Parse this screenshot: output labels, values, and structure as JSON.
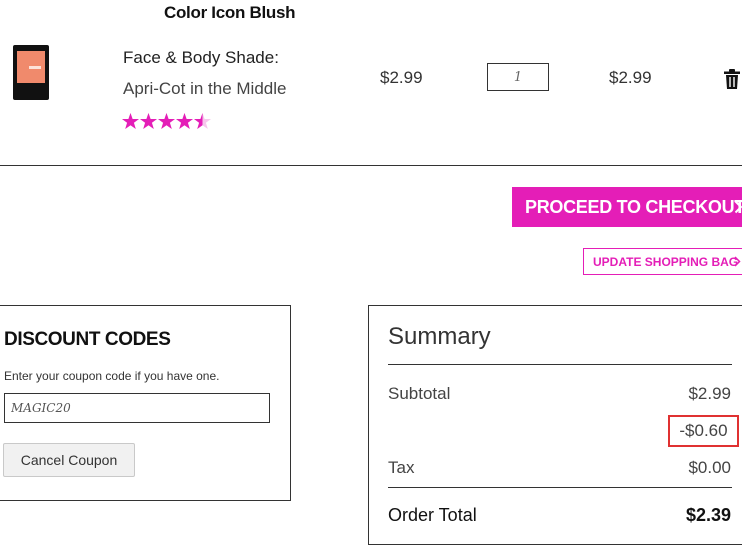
{
  "cart": {
    "product_name": "Color Icon Blush",
    "shade_label": "Face & Body Shade:",
    "shade_value": "Apri-Cot in the Middle",
    "rating": 4.5,
    "rating_max": 5,
    "unit_price": "$2.99",
    "quantity": "1",
    "line_total": "$2.99"
  },
  "actions": {
    "checkout_label": "PROCEED TO CHECKOUT",
    "update_label": "UPDATE SHOPPING BAG"
  },
  "discount": {
    "title": "DISCOUNT CODES",
    "hint": "Enter your coupon code if you have one.",
    "code_value": "MAGIC20",
    "cancel_label": "Cancel Coupon"
  },
  "summary": {
    "title": "Summary",
    "subtotal_label": "Subtotal",
    "subtotal_value": "$2.99",
    "discount_value": "-$0.60",
    "tax_label": "Tax",
    "tax_value": "$0.00",
    "total_label": "Order Total",
    "total_value": "$2.39"
  },
  "colors": {
    "accent": "#e41eb7",
    "highlight_box": "#e03131",
    "product_swatch": "#f08a6c"
  },
  "icons": {
    "star": "star-icon",
    "trash": "trash-icon",
    "chevron": "chevron-right-icon"
  }
}
